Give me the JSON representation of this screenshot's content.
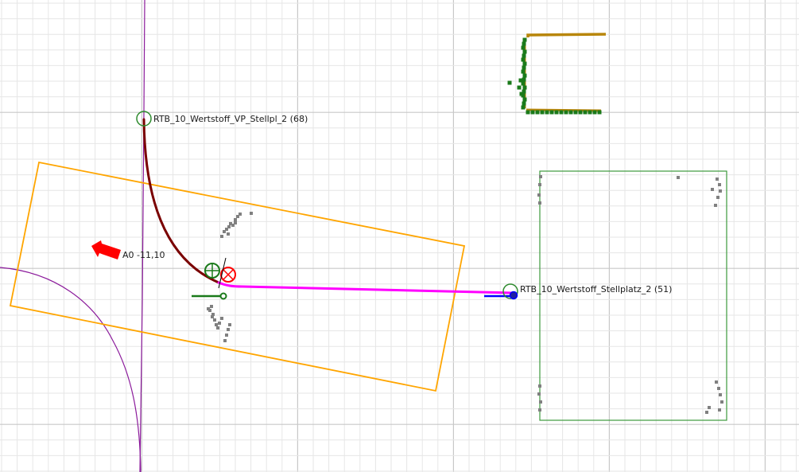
{
  "view": {
    "background": "#ffffff",
    "minor_grid_color": "#e6e6e6",
    "major_grid_color": "#c8c8c8"
  },
  "stations": {
    "start": {
      "label": "RTB_10_Wertstoff_VP_Stellpl_2 (68)",
      "color": "#2e8b2e"
    },
    "target": {
      "label": "RTB_10_Wertstoff_Stellplatz_2 (51)",
      "color": "#2e8b2e"
    }
  },
  "vehicle": {
    "label": "A0 -11,10",
    "arrow_color": "#ff0000",
    "footprint_color": "#ffa500"
  },
  "paths": {
    "traversed_color": "#7a0000",
    "planned_color": "#ff00ff",
    "guide_color": "#8b1a9b"
  },
  "markers": {
    "current_pose_color": "#1a7a1a",
    "goal_pose_color": "#ff0000",
    "target_heading_color": "#0000ff",
    "target_point_color": "#2020a0"
  },
  "zones": {
    "parking_area_color": "#3c9a3c",
    "scan_obstacle_color": "#808080",
    "scan_green_color": "#1a7a1a",
    "scan_gold_color": "#b8860b"
  }
}
